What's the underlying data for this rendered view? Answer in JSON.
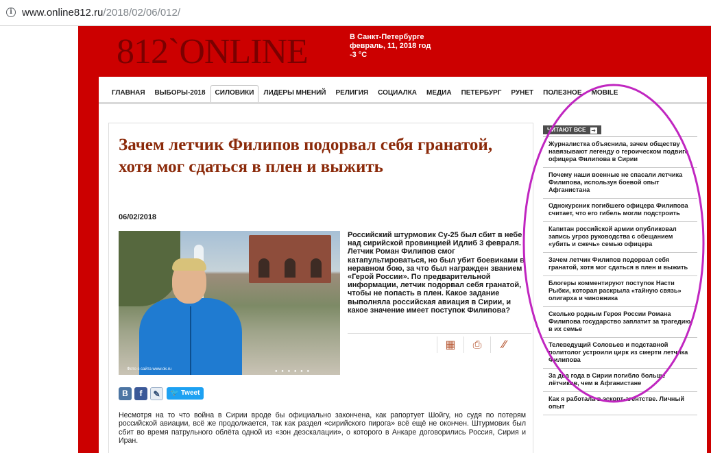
{
  "browser": {
    "url_host": "www.online812.ru",
    "url_path": "/2018/02/06/012/"
  },
  "site": {
    "logo": "812`ONLINE",
    "weather": {
      "city": "В Санкт-Петербурге",
      "date": "февраль, 11, 2018 год",
      "temp": "-3 °C"
    }
  },
  "nav": {
    "items": [
      {
        "label": "ГЛАВНАЯ"
      },
      {
        "label": "ВЫБОРЫ-2018"
      },
      {
        "label": "СИЛОВИКИ",
        "active": true
      },
      {
        "label": "ЛИДЕРЫ МНЕНИЙ"
      },
      {
        "label": "РЕЛИГИЯ"
      },
      {
        "label": "СОЦИАЛКА"
      },
      {
        "label": "МЕДИА"
      },
      {
        "label": "ПЕТЕРБУРГ"
      },
      {
        "label": "РУНЕТ"
      },
      {
        "label": "ПОЛЕЗНОЕ"
      },
      {
        "label": "MOBILE"
      }
    ]
  },
  "article": {
    "title": "Зачем летчик Филипов подорвал себя гранатой, хотя мог сдаться в плен и выжить",
    "date": "06/02/2018",
    "photo_caption": "Фото с сайта www.ok.ru",
    "lead": "Российский штурмовик Су-25 был сбит в небе над сирийской провинцией Идлиб 3 февраля. Летчик Роман Филипов смог катапультироваться, но был убит боевиками в неравном бою, за что был награжден званием «Герой России». По предварительной информации, летчик подорвал себя гранатой, чтобы не попасть в плен. Какое задание выполняла российская авиация в Сирии, и какое значение имеет поступок Филипова?",
    "social": {
      "vk": "В",
      "fb": "f",
      "lj": "✎",
      "tweet": "Tweet"
    },
    "body": "Несмотря на то что война в Сирии вроде бы официально закончена, как рапортует Шойгу, но судя по потерям российской авиации, всё же продолжается, так как раздел «сирийского пирога» всё ещё не окончен. Штурмовик был сбит во время патрульного облёта одной из «зон деэскалации», о которого  в Анкаре договорились Россия, Сирия и Иран."
  },
  "sidebar": {
    "heading": "ЧИТАЮТ ВСЕ",
    "items": [
      "Журналистка объяснила, зачем обществу навязывают легенду о героическом подвиге офицера Филипова в Сирии",
      "Почему наши военные не спасали летчика Филипова, используя боевой опыт Афганистана",
      "Однокурсник погибшего офицера Филипова считает, что его гибель могли подстроить",
      "Капитан российской армии опубликовал запись угроз руководства с обещанием «убить и сжечь» семью офицера",
      "Зачем летчик Филипов подорвал себя гранатой, хотя мог сдаться в плен и выжить",
      "Блогеры комментируют поступок Насти Рыбки, которая раскрыла «тайную связь» олигарха и чиновника",
      "Сколько родным Героя России Романа Филипова государство заплатит за трагедию в их семье",
      "Телеведущий Соловьев и подставной политолог устроили цирк из смерти летчика Филипова",
      "За два года в Сирии погибло больше лётчиков, чем в Афганистане",
      "Как я работала в эскорт-агентстве. Личный опыт"
    ]
  },
  "colors": {
    "site_red": "#cc0000",
    "title_brown": "#8b2a0a",
    "annotation_magenta": "#c026c0"
  }
}
